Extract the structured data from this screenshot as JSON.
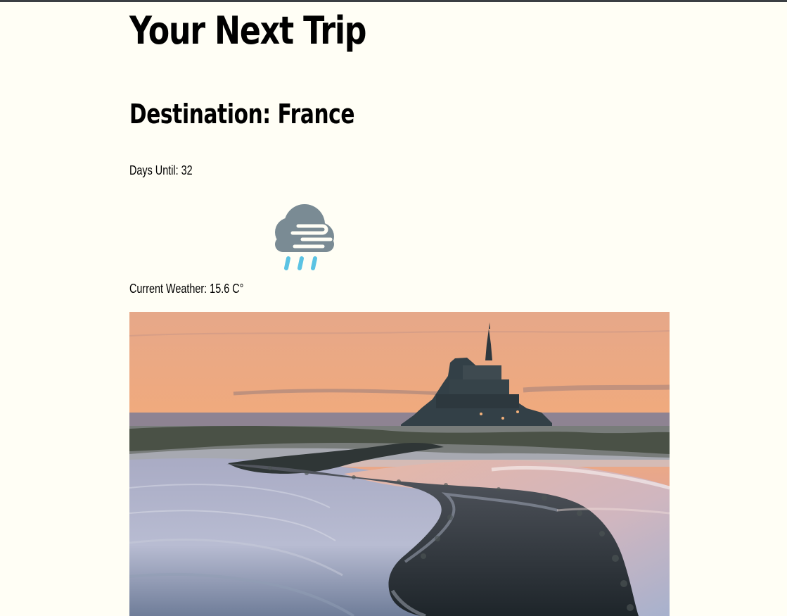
{
  "page": {
    "title": "Your Next Trip"
  },
  "trip": {
    "destination_label": "Destination: France",
    "days_until_label": "Days Until: 32",
    "current_weather_label": "Current Weather: 15.6 C°",
    "weather_icon": "rain-wind-cloud-icon"
  },
  "photo": {
    "subject": "mont-saint-michel-photo"
  },
  "colors": {
    "background": "#fffef5",
    "top_rule": "#3b3f43",
    "cloud": "#7a8b94",
    "rain": "#5bc3e3"
  }
}
